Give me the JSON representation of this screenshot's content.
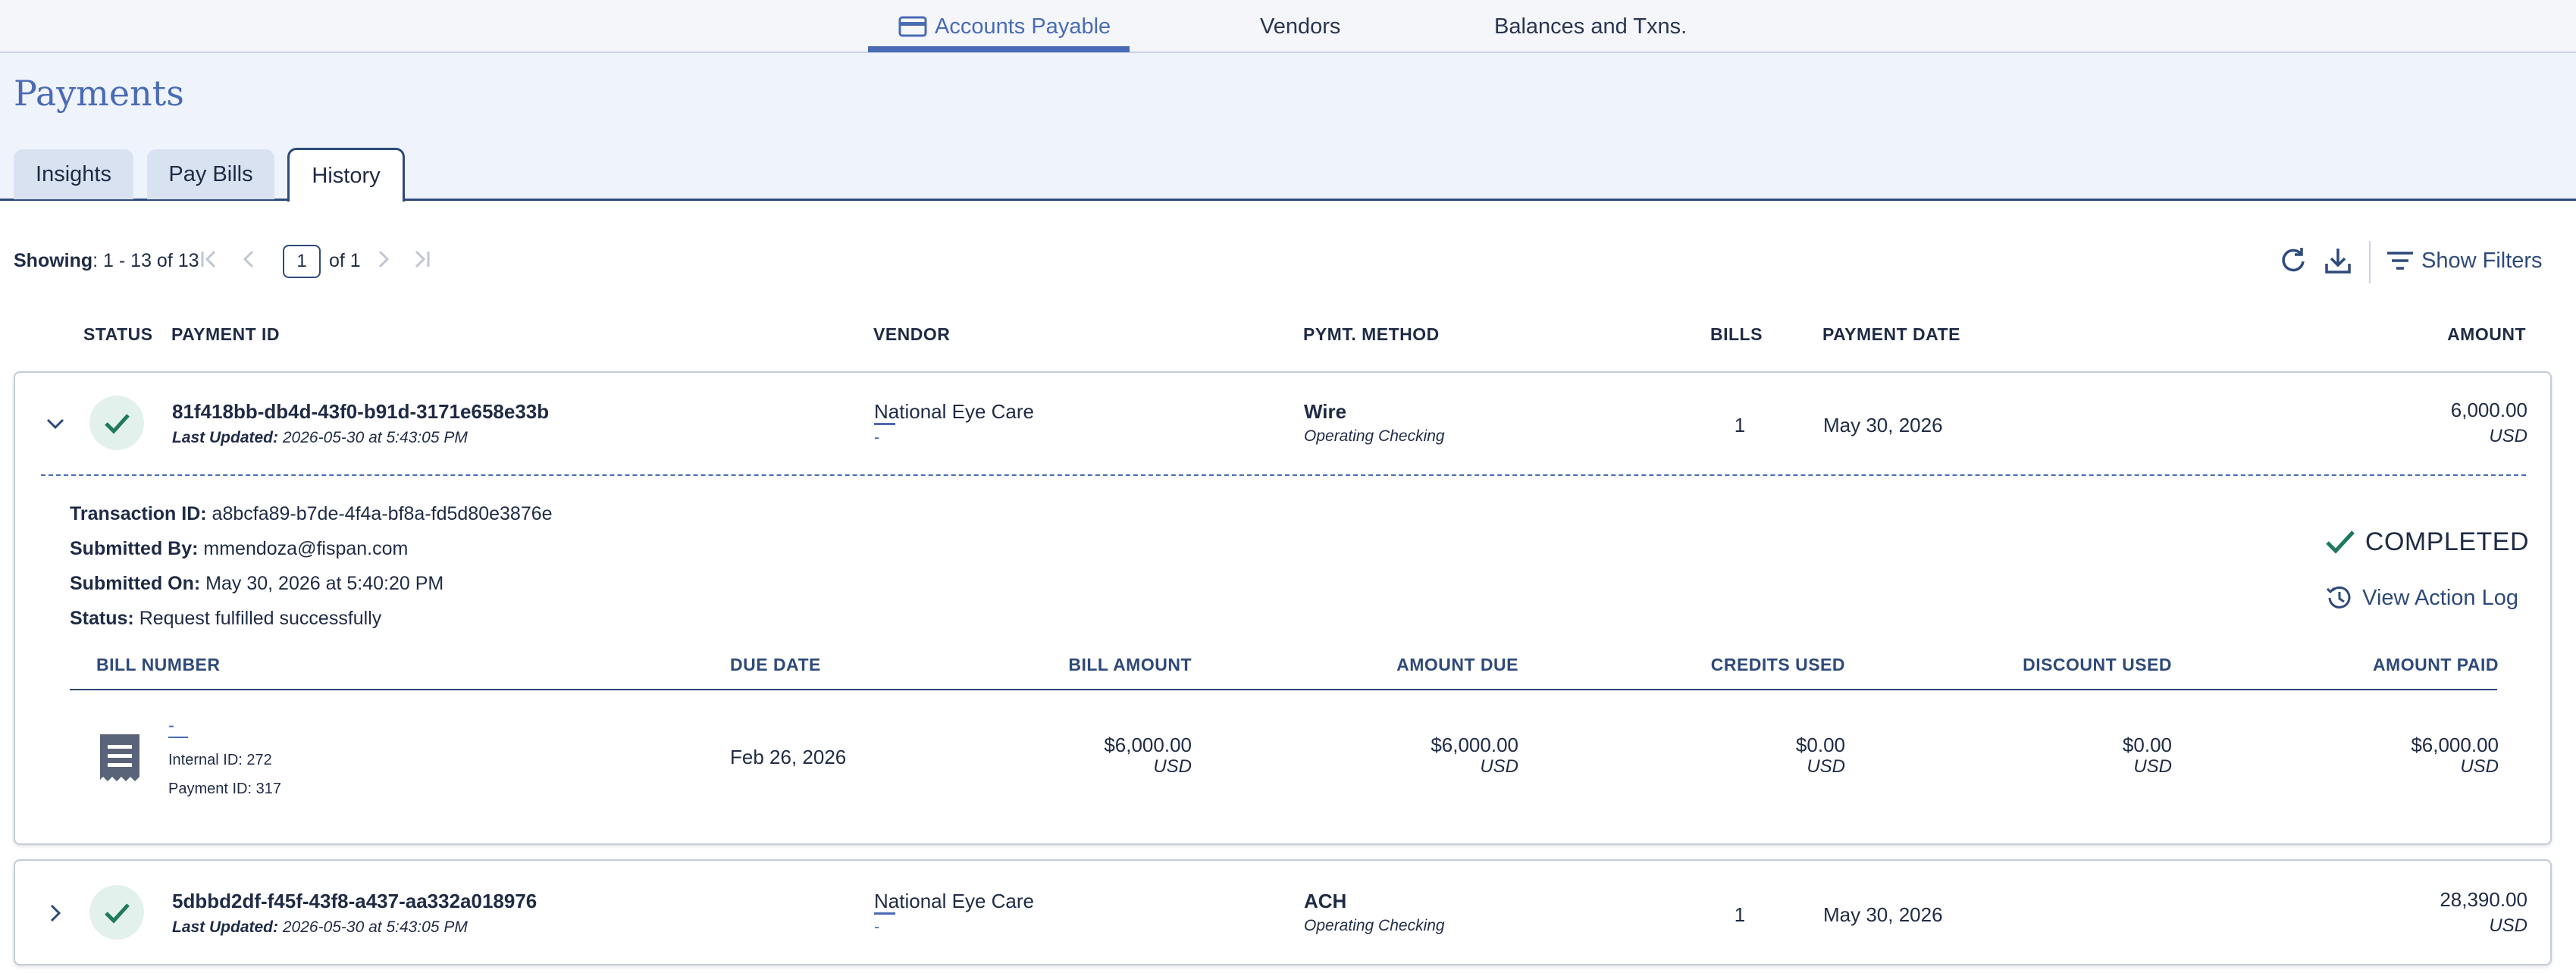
{
  "nav": {
    "items": [
      {
        "label": "Accounts Payable",
        "active": true,
        "icon": "card-icon"
      },
      {
        "label": "Vendors",
        "active": false
      },
      {
        "label": "Balances and Txns.",
        "active": false
      }
    ]
  },
  "page": {
    "title": "Payments",
    "tabs": [
      {
        "label": "Insights",
        "active": false
      },
      {
        "label": "Pay Bills",
        "active": false
      },
      {
        "label": "History",
        "active": true
      }
    ]
  },
  "toolbar": {
    "showing_label": "Showing",
    "showing_value": ": 1 - 13 of 13",
    "page_number": "1",
    "page_of": "of 1",
    "show_filters_label": "Show Filters"
  },
  "columns": {
    "status": "STATUS",
    "payment_id": "PAYMENT ID",
    "vendor": "VENDOR",
    "method": "PYMT. METHOD",
    "bills": "BILLS",
    "payment_date": "PAYMENT DATE",
    "amount": "AMOUNT"
  },
  "payments": [
    {
      "expanded": true,
      "payment_id": "81f418bb-db4d-43f0-b91d-3171e658e33b",
      "last_updated_label": "Last Updated:",
      "last_updated": "2026-05-30 at 5:43:05 PM",
      "vendor": "National Eye Care",
      "vendor_sub": "-",
      "method": "Wire",
      "method_sub": "Operating Checking",
      "bills": "1",
      "payment_date": "May 30, 2026",
      "amount": "6,000.00",
      "currency": "USD",
      "details": {
        "transaction_id_label": "Transaction ID:",
        "transaction_id": "a8bcfa89-b7de-4f4a-bf8a-fd5d80e3876e",
        "submitted_by_label": "Submitted By:",
        "submitted_by": "mmendoza@fispan.com",
        "submitted_on_label": "Submitted On:",
        "submitted_on": "May 30, 2026 at 5:40:20 PM",
        "status_label": "Status:",
        "status": "Request fulfilled successfully",
        "status_badge": "COMPLETED",
        "view_action_log": "View Action Log"
      },
      "bill_columns": {
        "bill_number": "BILL NUMBER",
        "due_date": "DUE DATE",
        "bill_amount": "BILL AMOUNT",
        "amount_due": "AMOUNT DUE",
        "credits_used": "CREDITS USED",
        "discount_used": "DISCOUNT USED",
        "amount_paid": "AMOUNT PAID"
      },
      "bill_rows": [
        {
          "bill_number": "-",
          "internal_id": "Internal ID: 272",
          "payment_id": "Payment ID: 317",
          "due_date": "Feb 26, 2026",
          "bill_amount": "$6,000.00",
          "amount_due": "$6,000.00",
          "credits_used": "$0.00",
          "discount_used": "$0.00",
          "amount_paid": "$6,000.00",
          "currency": "USD"
        }
      ]
    },
    {
      "expanded": false,
      "payment_id": "5dbbd2df-f45f-43f8-a437-aa332a018976",
      "last_updated_label": "Last Updated:",
      "last_updated": "2026-05-30 at 5:43:05 PM",
      "vendor": "National Eye Care",
      "vendor_sub": "-",
      "method": "ACH",
      "method_sub": "Operating Checking",
      "bills": "1",
      "payment_date": "May 30, 2026",
      "amount": "28,390.00",
      "currency": "USD"
    }
  ],
  "colors": {
    "accent": "#4a6bb5",
    "navy": "#2e4a7a",
    "success": "#1f7a5a",
    "success_bg": "#e3f1ec"
  }
}
